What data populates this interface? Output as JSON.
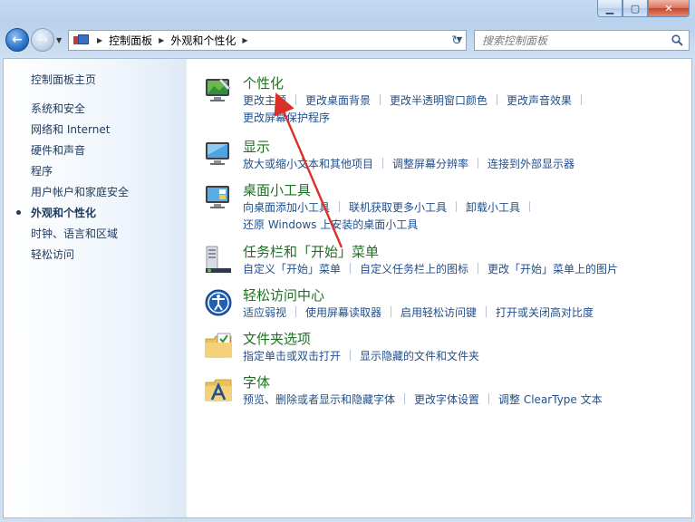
{
  "window": {
    "controls": {
      "minimize": "▁",
      "maximize": "▢",
      "close": "✕"
    }
  },
  "toolbar": {
    "back_icon": "back-arrow-icon",
    "forward_icon": "forward-arrow-icon",
    "breadcrumbs": [
      "控制面板",
      "外观和个性化"
    ],
    "search_placeholder": "搜索控制面板"
  },
  "sidebar": {
    "home": "控制面板主页",
    "items": [
      {
        "label": "系统和安全",
        "active": false
      },
      {
        "label": "网络和 Internet",
        "active": false
      },
      {
        "label": "硬件和声音",
        "active": false
      },
      {
        "label": "程序",
        "active": false
      },
      {
        "label": "用户帐户和家庭安全",
        "active": false
      },
      {
        "label": "外观和个性化",
        "active": true
      },
      {
        "label": "时钟、语言和区域",
        "active": false
      },
      {
        "label": "轻松访问",
        "active": false
      }
    ]
  },
  "categories": [
    {
      "title": "个性化",
      "icon": "personalization-icon",
      "links": [
        "更改主题",
        "更改桌面背景",
        "更改半透明窗口颜色",
        "更改声音效果",
        "更改屏幕保护程序"
      ]
    },
    {
      "title": "显示",
      "icon": "display-icon",
      "links": [
        "放大或缩小文本和其他项目",
        "调整屏幕分辨率",
        "连接到外部显示器"
      ]
    },
    {
      "title": "桌面小工具",
      "icon": "gadgets-icon",
      "links": [
        "向桌面添加小工具",
        "联机获取更多小工具",
        "卸载小工具",
        "还原 Windows 上安装的桌面小工具"
      ]
    },
    {
      "title": "任务栏和「开始」菜单",
      "icon": "taskbar-icon",
      "links": [
        "自定义「开始」菜单",
        "自定义任务栏上的图标",
        "更改「开始」菜单上的图片"
      ]
    },
    {
      "title": "轻松访问中心",
      "icon": "ease-of-access-icon",
      "links": [
        "适应弱视",
        "使用屏幕读取器",
        "启用轻松访问键",
        "打开或关闭高对比度"
      ]
    },
    {
      "title": "文件夹选项",
      "icon": "folder-options-icon",
      "links": [
        "指定单击或双击打开",
        "显示隐藏的文件和文件夹"
      ]
    },
    {
      "title": "字体",
      "icon": "fonts-icon",
      "links": [
        "预览、删除或者显示和隐藏字体",
        "更改字体设置",
        "调整 ClearType 文本"
      ]
    }
  ],
  "colors": {
    "category_title": "#1c7221",
    "link": "#1f4f8e",
    "annotation_arrow": "#d9312a"
  }
}
